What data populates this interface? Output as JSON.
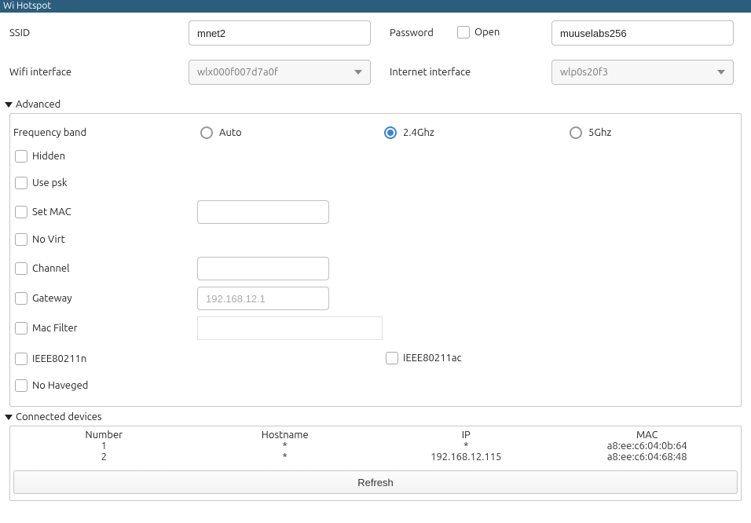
{
  "title": "Wi Hotspot",
  "basic": {
    "ssid_label": "SSID",
    "ssid_value": "mnet2",
    "password_label": "Password",
    "open_label": "Open",
    "password_value": "muuselabs256",
    "wifi_if_label": "Wifi interface",
    "wifi_if_value": "wlx000f007d7a0f",
    "inet_if_label": "Internet interface",
    "inet_if_value": "wlp0s20f3"
  },
  "advanced": {
    "header": "Advanced",
    "freq_label": "Frequency band",
    "freq_options": {
      "auto": "Auto",
      "g24": "2.4Ghz",
      "g5": "5Ghz"
    },
    "hidden": "Hidden",
    "use_psk": "Use psk",
    "set_mac": "Set MAC",
    "set_mac_value": "",
    "no_virt": "No Virt",
    "channel": "Channel",
    "channel_value": "",
    "gateway": "Gateway",
    "gateway_placeholder": "192.168.12.1",
    "mac_filter": "Mac Filter",
    "ieee_n": "IEEE80211n",
    "ieee_ac": "IEEE80211ac",
    "no_haveged": "No Haveged"
  },
  "devices": {
    "header": "Connected devices",
    "columns": {
      "number": "Number",
      "hostname": "Hostname",
      "ip": "IP",
      "mac": "MAC"
    },
    "rows": [
      {
        "number": "1",
        "hostname": "*",
        "ip": "*",
        "mac": "a8:ee:c6:04:0b:64"
      },
      {
        "number": "2",
        "hostname": "*",
        "ip": "192.168.12.115",
        "mac": "a8:ee:c6:04:68:48"
      }
    ],
    "refresh": "Refresh"
  }
}
